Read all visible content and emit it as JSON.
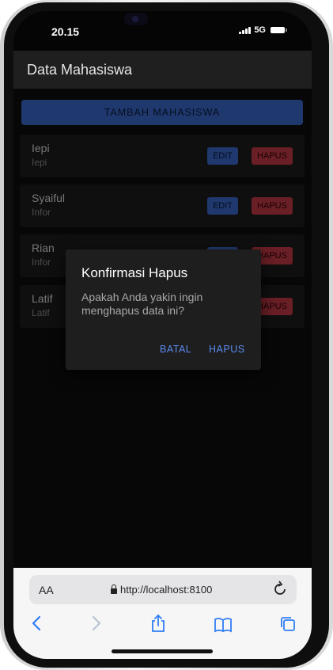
{
  "status": {
    "time": "20.15",
    "network": "5G"
  },
  "header": {
    "title": "Data Mahasiswa"
  },
  "add_button": {
    "label": "TAMBAH MAHASISWA"
  },
  "students": [
    {
      "name": "Iepi",
      "sub": "Iepi"
    },
    {
      "name": "Syaiful",
      "sub": "Infor"
    },
    {
      "name": "Rian",
      "sub": "Infor"
    },
    {
      "name": "Latif",
      "sub": "Latif"
    }
  ],
  "row_buttons": {
    "edit": "EDIT",
    "delete": "HAPUS"
  },
  "dialog": {
    "title": "Konfirmasi Hapus",
    "message": "Apakah Anda yakin ingin menghapus data ini?",
    "cancel": "BATAL",
    "confirm": "HAPUS"
  },
  "browser": {
    "text_size": "AA",
    "url": "http://localhost:8100"
  },
  "colors": {
    "primary": "#3a66c8",
    "danger": "#c03a44",
    "dialog_action": "#5b8bf0"
  },
  "icons": [
    "back-icon",
    "forward-icon",
    "share-icon",
    "bookmarks-icon",
    "tabs-icon",
    "reload-icon",
    "lock-icon"
  ]
}
